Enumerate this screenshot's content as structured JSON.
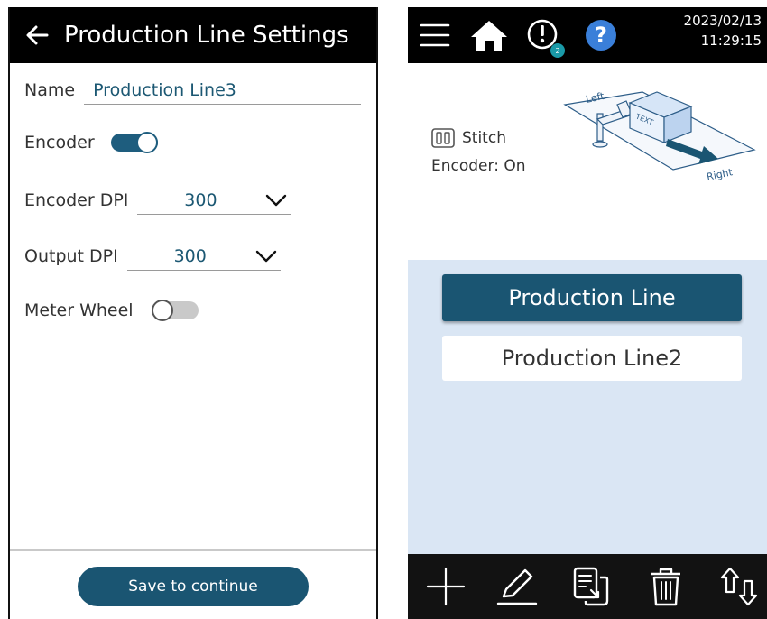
{
  "left_screen": {
    "title": "Production Line Settings",
    "name_label": "Name",
    "name_value": "Production Line3",
    "encoder_label": "Encoder",
    "encoder_on": true,
    "encoder_dpi_label": "Encoder DPI",
    "encoder_dpi_value": "300",
    "output_dpi_label": "Output DPI",
    "output_dpi_value": "300",
    "meter_wheel_label": "Meter Wheel",
    "meter_wheel_on": false,
    "save_label": "Save to continue",
    "icons": {
      "back": "arrow-left-icon",
      "dropdown": "chevron-down-icon"
    }
  },
  "right_screen": {
    "date": "2023/02/13",
    "time": "11:29:15",
    "alert_badge": "2",
    "stitch_label": "Stitch",
    "encoder_status": "Encoder: On",
    "diagram": {
      "left_label": "Left",
      "right_label": "Right",
      "box_label": "TEXT"
    },
    "production_lines": [
      {
        "label": "Production Line",
        "selected": true
      },
      {
        "label": "Production Line2",
        "selected": false
      }
    ],
    "icons": {
      "topbar": [
        "menu-icon",
        "home-icon",
        "alert-icon",
        "help-icon"
      ],
      "bottombar": [
        "add-icon",
        "edit-icon",
        "copy-icon",
        "delete-icon",
        "sort-icon"
      ]
    }
  },
  "colors": {
    "accent": "#1a5572",
    "value_text": "#1c5873",
    "help_blue": "#3a7fd9",
    "badge_teal": "#1a9aa8",
    "list_background": "#dae6f4"
  }
}
